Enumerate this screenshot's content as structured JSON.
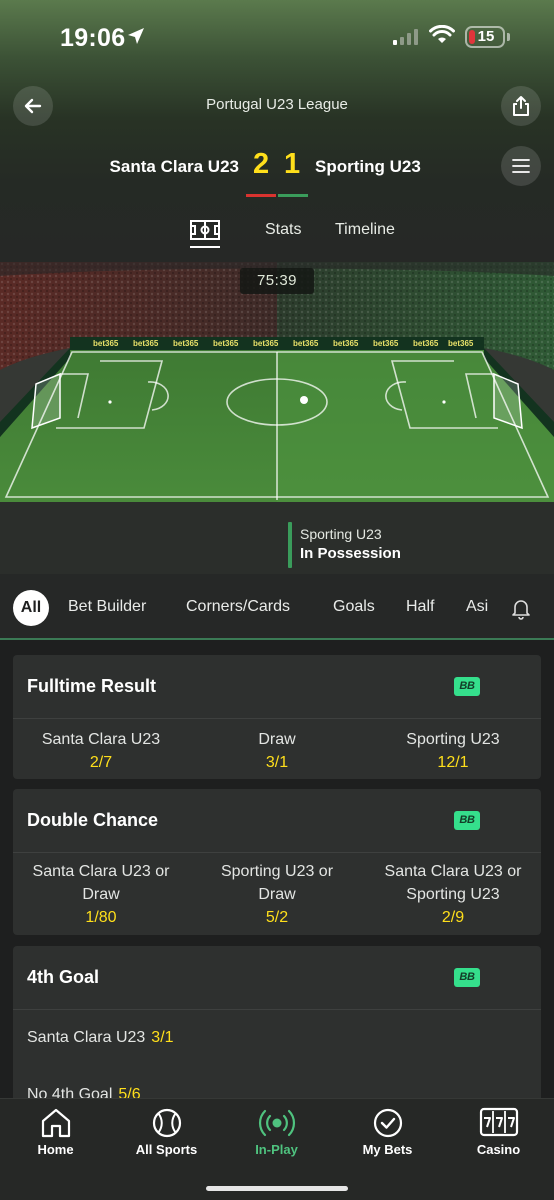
{
  "status_bar": {
    "time": "19:06",
    "battery": "15"
  },
  "header": {
    "league": "Portugal U23 League"
  },
  "match": {
    "home_team": "Santa Clara U23",
    "away_team": "Sporting U23",
    "home_score": "2",
    "away_score": "1",
    "clock": "75:39"
  },
  "tabs": [
    "Stats",
    "Timeline"
  ],
  "possession": {
    "team": "Sporting U23",
    "label": "In Possession"
  },
  "pitch": {
    "board_text": "bet365"
  },
  "filters": [
    "All",
    "Bet Builder",
    "Corners/Cards",
    "Goals",
    "Half",
    "Asi"
  ],
  "bb_badge": "BB",
  "markets": {
    "fulltime": {
      "title": "Fulltime Result",
      "outcomes": [
        {
          "name": "Santa Clara U23",
          "odds": "2/7"
        },
        {
          "name": "Draw",
          "odds": "3/1"
        },
        {
          "name": "Sporting U23",
          "odds": "12/1"
        }
      ]
    },
    "double_chance": {
      "title": "Double Chance",
      "outcomes": [
        {
          "name_l1": "Santa Clara U23 or",
          "name_l2": "Draw",
          "odds": "1/80"
        },
        {
          "name_l1": "Sporting U23 or",
          "name_l2": "Draw",
          "odds": "5/2"
        },
        {
          "name_l1": "Santa Clara U23 or",
          "name_l2": "Sporting U23",
          "odds": "2/9"
        }
      ]
    },
    "fourth_goal": {
      "title": "4th Goal",
      "outcomes": [
        {
          "name": "Santa Clara U23",
          "odds": "3/1"
        },
        {
          "name": "No 4th Goal",
          "odds": "5/6"
        }
      ]
    }
  },
  "nav": [
    {
      "label": "Home",
      "icon": "home-icon"
    },
    {
      "label": "All Sports",
      "icon": "ball-icon"
    },
    {
      "label": "In-Play",
      "icon": "live-icon",
      "active": true
    },
    {
      "label": "My Bets",
      "icon": "check-circle-icon"
    },
    {
      "label": "Casino",
      "icon": "slot-icon"
    }
  ],
  "colors": {
    "accent_green": "#35df8c",
    "odds_yellow": "#ffdf1b",
    "home_red": "#d9332f",
    "away_green": "#3a9c5b",
    "active_nav": "#4fc37f"
  }
}
